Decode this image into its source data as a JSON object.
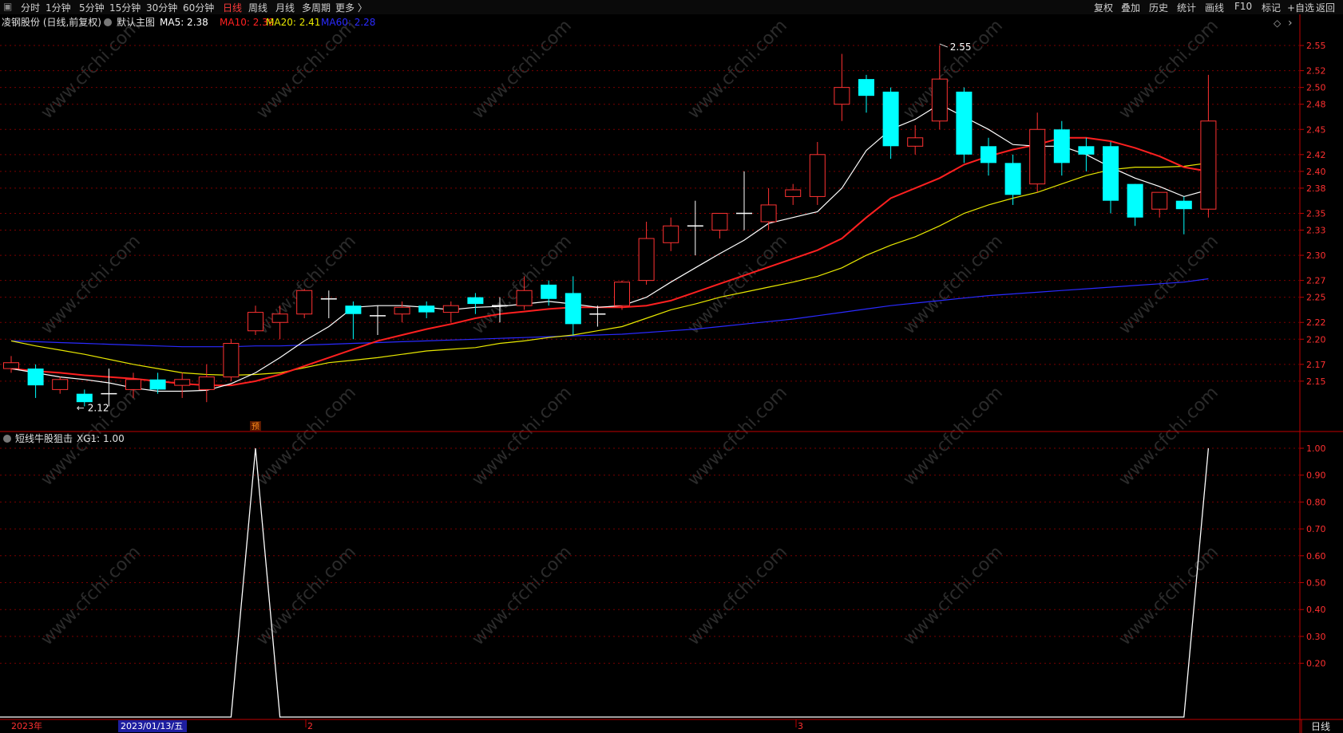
{
  "toolbar": {
    "left_items": [
      "分时",
      "1分钟",
      "5分钟",
      "15分钟",
      "30分钟",
      "60分钟",
      "日线",
      "周线",
      "月线",
      "多周期",
      "更多 〉"
    ],
    "active_item": "日线",
    "right_items": [
      "复权",
      "叠加",
      "历史",
      "统计",
      "画线",
      "F10",
      "+自选",
      "返回"
    ],
    "mark_label": "标记"
  },
  "main_panel": {
    "stock_title": "凌钢股份 (日线,前复权)",
    "indicator_name": "默认主图",
    "ma_labels": [
      {
        "text": "MA5: 2.38",
        "color": "#ffffff"
      },
      {
        "text": "MA10: 2.39",
        "color": "#ff2020"
      },
      {
        "text": "MA20: 2.41",
        "color": "#e8e800"
      },
      {
        "text": "MA60: 2.28",
        "color": "#2a2aff"
      }
    ],
    "high_label": "2.55",
    "low_label": "2.12",
    "marker_text": "预",
    "y_ticks": [
      "2.55",
      "2.52",
      "2.50",
      "2.48",
      "2.45",
      "2.42",
      "2.40",
      "2.38",
      "2.35",
      "2.33",
      "2.30",
      "2.27",
      "2.25",
      "2.22",
      "2.20",
      "2.17",
      "2.15"
    ]
  },
  "sub_panel": {
    "indicator_name": "短线牛股狙击",
    "value_label": "XG1: 1.00",
    "y_ticks": [
      "1.00",
      "0.90",
      "0.80",
      "0.70",
      "0.60",
      "0.50",
      "0.40",
      "0.30",
      "0.20"
    ]
  },
  "x_axis": {
    "labels": [
      "2023年",
      "2",
      "3"
    ],
    "cursor_date": "2023/01/13/五",
    "period_label": "日线"
  },
  "watermark": "www.cfchi.com",
  "colors": {
    "up": "#ff3232",
    "down": "#00ffff",
    "grid": "#7a0000",
    "axis": "#c00000"
  },
  "chart_data": {
    "type": "candlestick",
    "candles": [
      {
        "o": 2.165,
        "h": 2.18,
        "l": 2.16,
        "c": 2.172
      },
      {
        "o": 2.165,
        "h": 2.17,
        "l": 2.13,
        "c": 2.145
      },
      {
        "o": 2.14,
        "h": 2.155,
        "l": 2.135,
        "c": 2.152
      },
      {
        "o": 2.135,
        "h": 2.14,
        "l": 2.12,
        "c": 2.125
      },
      {
        "o": 2.135,
        "h": 2.165,
        "l": 2.12,
        "c": 2.135
      },
      {
        "o": 2.14,
        "h": 2.16,
        "l": 2.13,
        "c": 2.152
      },
      {
        "o": 2.152,
        "h": 2.16,
        "l": 2.135,
        "c": 2.14
      },
      {
        "o": 2.145,
        "h": 2.16,
        "l": 2.13,
        "c": 2.152
      },
      {
        "o": 2.14,
        "h": 2.17,
        "l": 2.125,
        "c": 2.155
      },
      {
        "o": 2.155,
        "h": 2.2,
        "l": 2.15,
        "c": 2.195
      },
      {
        "o": 2.21,
        "h": 2.24,
        "l": 2.205,
        "c": 2.232
      },
      {
        "o": 2.22,
        "h": 2.24,
        "l": 2.2,
        "c": 2.23
      },
      {
        "o": 2.23,
        "h": 2.26,
        "l": 2.225,
        "c": 2.258
      },
      {
        "o": 2.248,
        "h": 2.258,
        "l": 2.225,
        "c": 2.248
      },
      {
        "o": 2.24,
        "h": 2.245,
        "l": 2.2,
        "c": 2.23
      },
      {
        "o": 2.228,
        "h": 2.24,
        "l": 2.205,
        "c": 2.228
      },
      {
        "o": 2.23,
        "h": 2.245,
        "l": 2.22,
        "c": 2.238
      },
      {
        "o": 2.24,
        "h": 2.245,
        "l": 2.225,
        "c": 2.232
      },
      {
        "o": 2.232,
        "h": 2.245,
        "l": 2.22,
        "c": 2.24
      },
      {
        "o": 2.25,
        "h": 2.255,
        "l": 2.23,
        "c": 2.242
      },
      {
        "o": 2.24,
        "h": 2.25,
        "l": 2.22,
        "c": 2.24
      },
      {
        "o": 2.24,
        "h": 2.275,
        "l": 2.235,
        "c": 2.258
      },
      {
        "o": 2.265,
        "h": 2.27,
        "l": 2.24,
        "c": 2.248
      },
      {
        "o": 2.255,
        "h": 2.275,
        "l": 2.205,
        "c": 2.218
      },
      {
        "o": 2.23,
        "h": 2.24,
        "l": 2.215,
        "c": 2.23
      },
      {
        "o": 2.24,
        "h": 2.27,
        "l": 2.235,
        "c": 2.268
      },
      {
        "o": 2.27,
        "h": 2.34,
        "l": 2.265,
        "c": 2.32
      },
      {
        "o": 2.315,
        "h": 2.345,
        "l": 2.305,
        "c": 2.335
      },
      {
        "o": 2.335,
        "h": 2.365,
        "l": 2.3,
        "c": 2.335
      },
      {
        "o": 2.33,
        "h": 2.35,
        "l": 2.32,
        "c": 2.35
      },
      {
        "o": 2.35,
        "h": 2.4,
        "l": 2.33,
        "c": 2.35
      },
      {
        "o": 2.34,
        "h": 2.38,
        "l": 2.33,
        "c": 2.36
      },
      {
        "o": 2.37,
        "h": 2.385,
        "l": 2.36,
        "c": 2.378
      },
      {
        "o": 2.37,
        "h": 2.435,
        "l": 2.36,
        "c": 2.42
      },
      {
        "o": 2.48,
        "h": 2.54,
        "l": 2.46,
        "c": 2.5
      },
      {
        "o": 2.51,
        "h": 2.515,
        "l": 2.47,
        "c": 2.49
      },
      {
        "o": 2.495,
        "h": 2.5,
        "l": 2.415,
        "c": 2.43
      },
      {
        "o": 2.43,
        "h": 2.455,
        "l": 2.42,
        "c": 2.44
      },
      {
        "o": 2.46,
        "h": 2.55,
        "l": 2.45,
        "c": 2.51
      },
      {
        "o": 2.495,
        "h": 2.5,
        "l": 2.41,
        "c": 2.42
      },
      {
        "o": 2.43,
        "h": 2.44,
        "l": 2.395,
        "c": 2.41
      },
      {
        "o": 2.41,
        "h": 2.42,
        "l": 2.36,
        "c": 2.372
      },
      {
        "o": 2.385,
        "h": 2.47,
        "l": 2.375,
        "c": 2.45
      },
      {
        "o": 2.45,
        "h": 2.46,
        "l": 2.395,
        "c": 2.41
      },
      {
        "o": 2.43,
        "h": 2.44,
        "l": 2.4,
        "c": 2.42
      },
      {
        "o": 2.43,
        "h": 2.435,
        "l": 2.35,
        "c": 2.365
      },
      {
        "o": 2.385,
        "h": 2.385,
        "l": 2.335,
        "c": 2.345
      },
      {
        "o": 2.355,
        "h": 2.375,
        "l": 2.345,
        "c": 2.375
      },
      {
        "o": 2.365,
        "h": 2.37,
        "l": 2.325,
        "c": 2.355
      },
      {
        "o": 2.355,
        "h": 2.515,
        "l": 2.345,
        "c": 2.46
      }
    ],
    "ma5": [
      2.165,
      2.16,
      2.155,
      2.152,
      2.148,
      2.142,
      2.138,
      2.138,
      2.139,
      2.147,
      2.16,
      2.178,
      2.198,
      2.215,
      2.238,
      2.24,
      2.24,
      2.238,
      2.235,
      2.238,
      2.239,
      2.242,
      2.245,
      2.242,
      2.238,
      2.24,
      2.25,
      2.268,
      2.285,
      2.302,
      2.318,
      2.338,
      2.345,
      2.352,
      2.38,
      2.425,
      2.45,
      2.462,
      2.48,
      2.465,
      2.45,
      2.432,
      2.43,
      2.43,
      2.42,
      2.405,
      2.392,
      2.382,
      2.37,
      2.378
    ],
    "ma10": [
      2.165,
      2.162,
      2.16,
      2.157,
      2.155,
      2.153,
      2.15,
      2.147,
      2.145,
      2.145,
      2.15,
      2.158,
      2.168,
      2.178,
      2.188,
      2.198,
      2.205,
      2.212,
      2.218,
      2.225,
      2.23,
      2.233,
      2.236,
      2.238,
      2.238,
      2.238,
      2.24,
      2.246,
      2.256,
      2.266,
      2.276,
      2.286,
      2.296,
      2.306,
      2.32,
      2.345,
      2.368,
      2.38,
      2.392,
      2.408,
      2.418,
      2.426,
      2.432,
      2.44,
      2.44,
      2.436,
      2.428,
      2.418,
      2.405,
      2.4
    ],
    "ma20": [
      2.198,
      2.192,
      2.187,
      2.182,
      2.176,
      2.17,
      2.165,
      2.16,
      2.158,
      2.157,
      2.158,
      2.16,
      2.166,
      2.172,
      2.175,
      2.178,
      2.182,
      2.186,
      2.188,
      2.19,
      2.195,
      2.198,
      2.202,
      2.205,
      2.21,
      2.215,
      2.225,
      2.235,
      2.242,
      2.25,
      2.256,
      2.262,
      2.268,
      2.275,
      2.285,
      2.3,
      2.312,
      2.322,
      2.335,
      2.35,
      2.36,
      2.368,
      2.375,
      2.385,
      2.395,
      2.402,
      2.405,
      2.405,
      2.406,
      2.41
    ],
    "ma60": [
      2.198,
      2.197,
      2.196,
      2.195,
      2.194,
      2.193,
      2.192,
      2.191,
      2.191,
      2.191,
      2.192,
      2.192,
      2.193,
      2.194,
      2.195,
      2.196,
      2.197,
      2.198,
      2.199,
      2.2,
      2.201,
      2.202,
      2.203,
      2.204,
      2.205,
      2.206,
      2.208,
      2.21,
      2.212,
      2.215,
      2.218,
      2.221,
      2.224,
      2.228,
      2.232,
      2.236,
      2.24,
      2.243,
      2.246,
      2.249,
      2.252,
      2.254,
      2.256,
      2.258,
      2.26,
      2.262,
      2.264,
      2.266,
      2.268,
      2.272
    ],
    "xg1": [
      0,
      0,
      0,
      0,
      0,
      0,
      0,
      0,
      0,
      0,
      1,
      0,
      0,
      0,
      0,
      0,
      0,
      0,
      0,
      0,
      0,
      0,
      0,
      0,
      0,
      0,
      0,
      0,
      0,
      0,
      0,
      0,
      0,
      0,
      0,
      0,
      0,
      0,
      0,
      0,
      0,
      0,
      0,
      0,
      0,
      0,
      0,
      0,
      0,
      1
    ],
    "price_ylim": [
      2.09,
      2.57
    ],
    "sub_ylim": [
      0,
      1
    ]
  }
}
